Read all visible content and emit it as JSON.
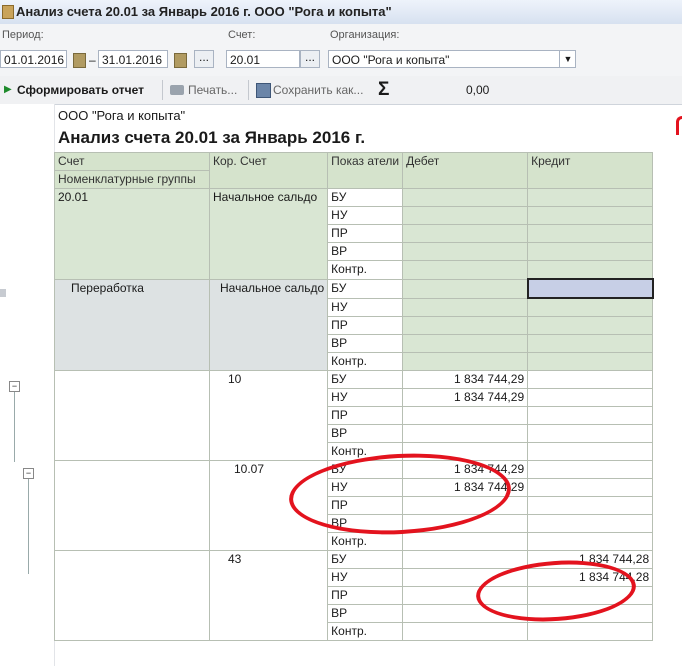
{
  "window": {
    "title": "Анализ счета 20.01 за Январь 2016 г. ООО \"Рога и копыта\""
  },
  "params": {
    "period_label": "Период:",
    "period_from": "01.01.2016",
    "period_dash": "–",
    "period_to": "31.01.2016",
    "period_button": "...",
    "account_label": "Счет:",
    "account_value": "20.01",
    "account_button": "...",
    "org_label": "Организация:",
    "org_value": "ООО \"Рога и копыта\"",
    "org_dropdown": "▼"
  },
  "toolbar": {
    "generate_label": "Сформировать отчет",
    "generate_icon": "▶",
    "print_label": "Печать...",
    "save_label": "Сохранить как...",
    "sigma": "Σ",
    "sum_value": "0,00"
  },
  "report": {
    "org_name": "ООО \"Рога и копыта\"",
    "title": "Анализ счета 20.01 за Январь 2016 г.",
    "headers": {
      "account": "Счет",
      "nomenclature": "Номенклатурные группы",
      "corr_account": "Кор. Счет",
      "indicators": "Показ атели",
      "debit": "Дебет",
      "credit": "Кредит"
    },
    "indicators": [
      "БУ",
      "НУ",
      "ПР",
      "ВР",
      "Контр."
    ],
    "groups": [
      {
        "account": "20.01",
        "corr": "Начальное сальдо",
        "debit": [
          "",
          "",
          "",
          "",
          ""
        ],
        "credit": [
          "",
          "",
          "",
          "",
          ""
        ]
      },
      {
        "account": "Переработка",
        "corr": "Начальное сальдо",
        "debit": [
          "",
          "",
          "",
          "",
          ""
        ],
        "credit": [
          "",
          "",
          "",
          "",
          ""
        ]
      },
      {
        "account": "",
        "corr": "10",
        "debit": [
          "1 834 744,29",
          "1 834 744,29",
          "",
          "",
          ""
        ],
        "credit": [
          "",
          "",
          "",
          "",
          ""
        ]
      },
      {
        "account": "",
        "corr": "10.07",
        "debit": [
          "1 834 744,29",
          "1 834 744,29",
          "",
          "",
          ""
        ],
        "credit": [
          "",
          "",
          "",
          "",
          ""
        ]
      },
      {
        "account": "",
        "corr": "43",
        "debit": [
          "",
          "",
          "",
          "",
          ""
        ],
        "credit": [
          "1 834 744,28",
          "1 834 744,28",
          "",
          "",
          ""
        ]
      }
    ]
  },
  "icons": {
    "window": "document-icon",
    "calendar": "calendar-icon",
    "print": "printer-icon",
    "save": "floppy-disk-icon",
    "sigma": "sum-icon",
    "tree": "tree-collapse-icon"
  },
  "colors": {
    "header_bg": "#d5e3cc",
    "group_bg": "#d9e6d3",
    "annotation": "#e3131e"
  }
}
